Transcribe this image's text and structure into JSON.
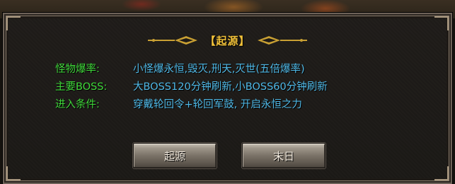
{
  "dialog": {
    "title": "【起源】",
    "rows": [
      {
        "label": "怪物爆率:",
        "value": "小怪爆永恒,毁灭,刑天,灭世(五倍爆率)"
      },
      {
        "label": "主要BOSS:",
        "value": "大BOSS120分钟刷新,小BOSS60分钟刷新"
      },
      {
        "label": "进入条件:",
        "value": "穿戴轮回令+轮回军鼓, 开启永恒之力"
      }
    ],
    "buttons": {
      "origin_label": "起源",
      "end_label": "末日"
    }
  },
  "colors": {
    "title": "#f2c23a",
    "label_green": "#3fd83a",
    "value_blue": "#4fb8e6",
    "ornament_gold": "#c9a033"
  }
}
